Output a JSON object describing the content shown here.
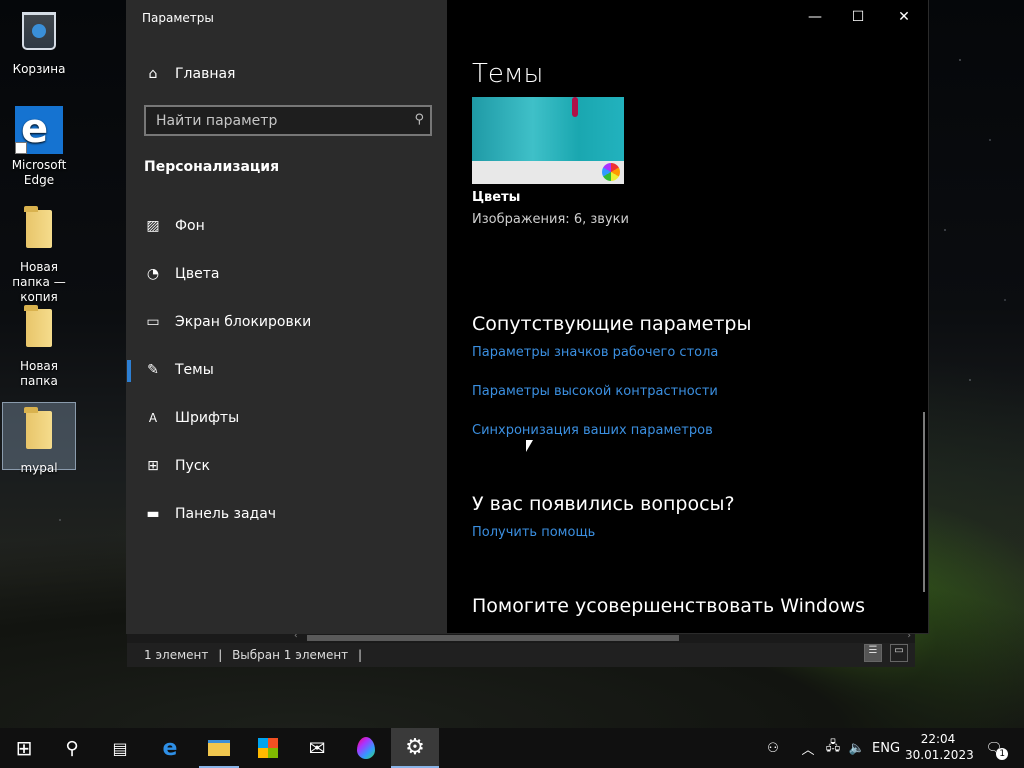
{
  "desktop": {
    "icons": [
      {
        "label": "Корзина",
        "icon": "recycle-bin-icon"
      },
      {
        "label": "Microsoft Edge",
        "icon": "edge-icon"
      },
      {
        "label": "Новая папка — копия",
        "icon": "folder-icon"
      },
      {
        "label": "Новая папка",
        "icon": "folder-icon"
      },
      {
        "label": "mypal",
        "icon": "folder-icon"
      }
    ]
  },
  "window": {
    "title": "Параметры",
    "controls": {
      "minimize": "—",
      "maximize": "☐",
      "close": "✕"
    }
  },
  "sidebar": {
    "home_label": "Главная",
    "search_placeholder": "Найти параметр",
    "section_title": "Персонализация",
    "items": [
      {
        "label": "Фон",
        "icon": "image-icon"
      },
      {
        "label": "Цвета",
        "icon": "palette-icon"
      },
      {
        "label": "Экран блокировки",
        "icon": "lock-screen-icon"
      },
      {
        "label": "Темы",
        "icon": "brush-icon",
        "active": true
      },
      {
        "label": "Шрифты",
        "icon": "font-icon"
      },
      {
        "label": "Пуск",
        "icon": "start-icon"
      },
      {
        "label": "Панель задач",
        "icon": "taskbar-icon"
      }
    ]
  },
  "main": {
    "heading": "Темы",
    "theme": {
      "name": "Цветы",
      "description": "Изображения: 6, звуки"
    },
    "related": {
      "heading": "Сопутствующие параметры",
      "links": [
        "Параметры значков рабочего стола",
        "Параметры высокой контрастности",
        "Синхронизация ваших параметров"
      ]
    },
    "questions": {
      "heading": "У вас появились вопросы?",
      "link": "Получить помощь"
    },
    "improve": {
      "heading": "Помогите усовершенствовать Windows"
    }
  },
  "explorer": {
    "status_count": "1 элемент",
    "status_selected": "Выбран 1 элемент"
  },
  "taskbar": {
    "apps": [
      "start-icon",
      "search-icon",
      "task-view-icon",
      "edge-icon",
      "file-explorer-icon",
      "store-icon",
      "mail-icon",
      "paint3d-icon",
      "settings-icon"
    ],
    "tray": {
      "language": "ENG",
      "time": "22:04",
      "date": "30.01.2023",
      "notification_count": "1"
    }
  },
  "colors": {
    "accent": "#3b8fe0",
    "sidebar_bg": "#2b2b2b",
    "content_bg": "#000000"
  }
}
